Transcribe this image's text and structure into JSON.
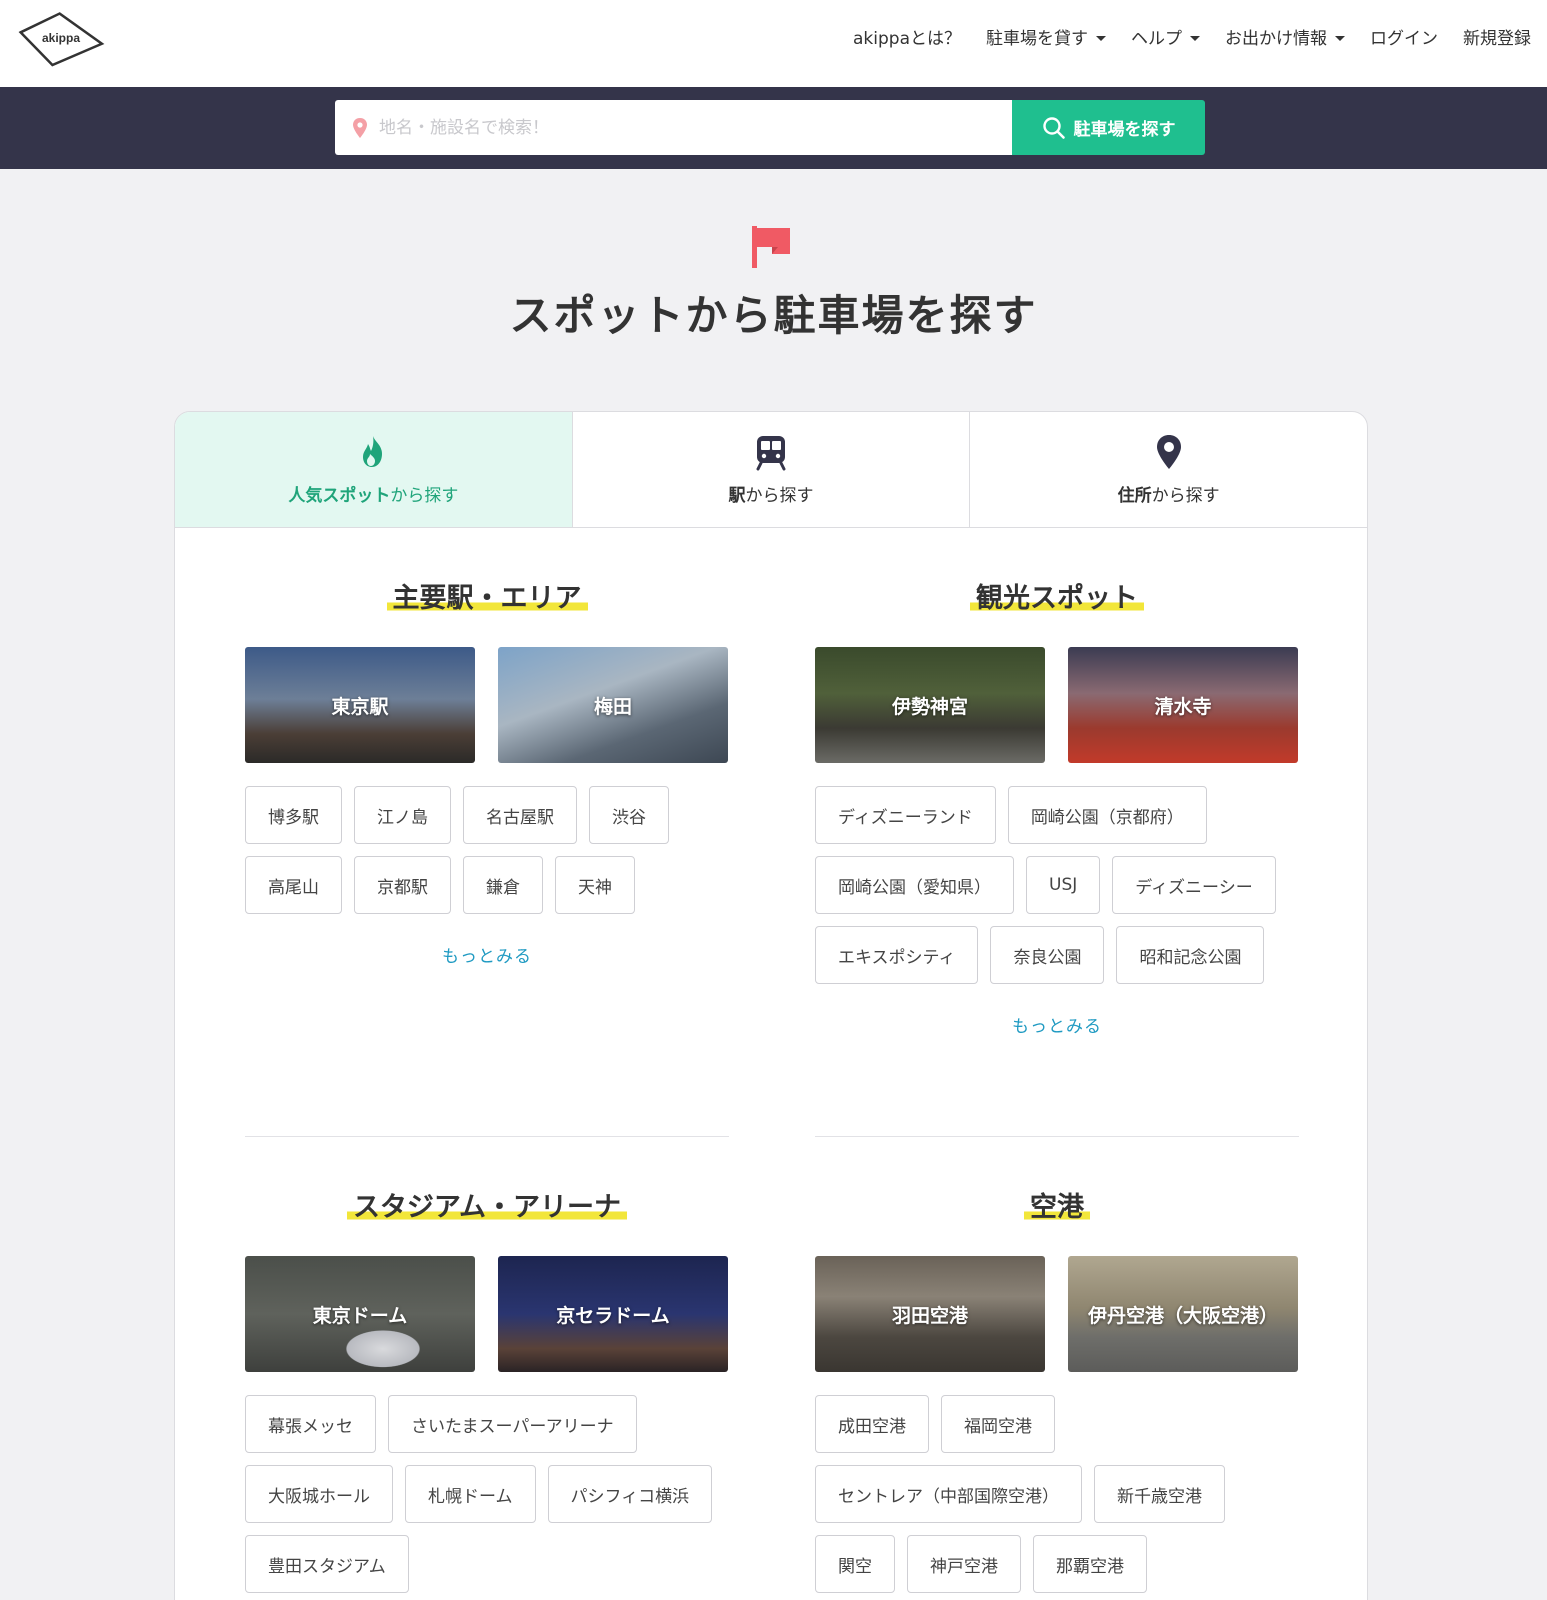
{
  "header": {
    "logo_text": "akippa",
    "nav": [
      {
        "label": "akippaとは？",
        "dropdown": false
      },
      {
        "label": "駐車場を貸す",
        "dropdown": true
      },
      {
        "label": "ヘルプ",
        "dropdown": true
      },
      {
        "label": "お出かけ情報",
        "dropdown": true
      },
      {
        "label": "ログイン",
        "dropdown": false
      },
      {
        "label": "新規登録",
        "dropdown": false
      }
    ]
  },
  "search": {
    "placeholder": "地名・施設名で検索！",
    "button_label": "駐車場を探す",
    "button_color": "#1fbf8f"
  },
  "page_title": "スポットから駐車場を探す",
  "tabs": [
    {
      "label_bold": "人気スポット",
      "label_rest": "から探す",
      "icon": "flame-icon",
      "active": true
    },
    {
      "label_bold": "駅",
      "label_rest": "から探す",
      "icon": "train-icon",
      "active": false
    },
    {
      "label_bold": "住所",
      "label_rest": "から探す",
      "icon": "map-pin-icon",
      "active": false
    }
  ],
  "sections": {
    "stations": {
      "title": "主要駅・エリア",
      "photos": [
        "東京駅",
        "梅田"
      ],
      "chips": [
        "博多駅",
        "江ノ島",
        "名古屋駅",
        "渋谷",
        "高尾山",
        "京都駅",
        "鎌倉",
        "天神"
      ],
      "more": "もっとみる"
    },
    "sightseeing": {
      "title": "観光スポット",
      "photos": [
        "伊勢神宮",
        "清水寺"
      ],
      "chips": [
        "ディズニーランド",
        "岡崎公園（京都府）",
        "岡崎公園（愛知県）",
        "USJ",
        "ディズニーシー",
        "エキスポシティ",
        "奈良公園",
        "昭和記念公園"
      ],
      "more": "もっとみる"
    },
    "stadiums": {
      "title": "スタジアム・アリーナ",
      "photos": [
        "東京ドーム",
        "京セラドーム"
      ],
      "chips": [
        "幕張メッセ",
        "さいたまスーパーアリーナ",
        "大阪城ホール",
        "札幌ドーム",
        "パシフィコ横浜",
        "豊田スタジアム"
      ]
    },
    "airports": {
      "title": "空港",
      "photos": [
        "羽田空港",
        "伊丹空港（大阪空港）"
      ],
      "chips": [
        "成田空港",
        "福岡空港",
        "セントレア（中部国際空港）",
        "新千歳空港",
        "関空",
        "神戸空港",
        "那覇空港"
      ]
    }
  },
  "colors": {
    "accent": "#1fbf8f",
    "header_band": "#34344a",
    "flag": "#f05a64",
    "highlight": "#f2e63a",
    "link": "#1f9ac2"
  }
}
